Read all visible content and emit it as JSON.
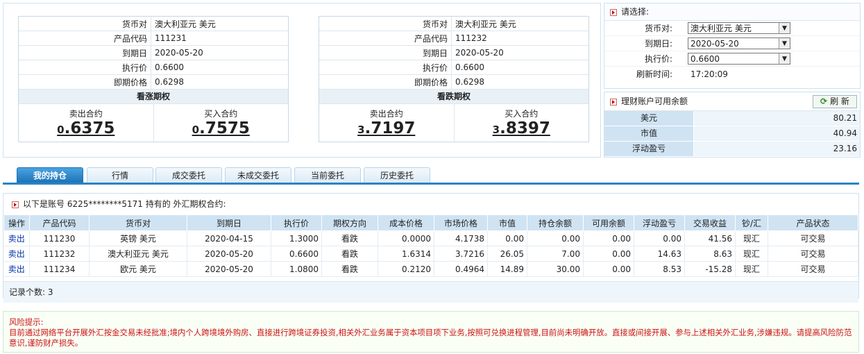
{
  "quotes": [
    {
      "pair_label": "货币对",
      "pair": "澳大利亚元 美元",
      "code_label": "产品代码",
      "code": "111231",
      "expiry_label": "到期日",
      "expiry": "2020-05-20",
      "strike_label": "执行价",
      "strike": "0.6600",
      "spot_label": "即期价格",
      "spot": "0.6298",
      "type": "看涨期权",
      "sell_label": "卖出合约",
      "sell_int": "0",
      "sell_dec": ".6375",
      "buy_label": "买入合约",
      "buy_int": "0",
      "buy_dec": ".7575"
    },
    {
      "pair_label": "货币对",
      "pair": "澳大利亚元 美元",
      "code_label": "产品代码",
      "code": "111232",
      "expiry_label": "到期日",
      "expiry": "2020-05-20",
      "strike_label": "执行价",
      "strike": "0.6600",
      "spot_label": "即期价格",
      "spot": "0.6298",
      "type": "看跌期权",
      "sell_label": "卖出合约",
      "sell_int": "3",
      "sell_dec": ".7197",
      "buy_label": "买入合约",
      "buy_int": "3",
      "buy_dec": ".8397"
    }
  ],
  "select": {
    "title": "请选择:",
    "pair_label": "货币对:",
    "pair": "澳大利亚元 美元",
    "expiry_label": "到期日:",
    "expiry": "2020-05-20",
    "strike_label": "执行价:",
    "strike": "0.6600",
    "refresh_label": "刷新时间:",
    "refresh_time": "17:20:09"
  },
  "balance": {
    "title": "理财账户可用余额",
    "refresh_btn": "刷 新",
    "rows": [
      {
        "k": "美元",
        "v": "80.21"
      },
      {
        "k": "市值",
        "v": "40.94"
      },
      {
        "k": "浮动盈亏",
        "v": "23.16"
      }
    ]
  },
  "tabs": [
    "我的持仓",
    "行情",
    "成交委托",
    "未成交委托",
    "当前委托",
    "历史委托"
  ],
  "holdings": {
    "header": "以下是账号 6225********5171 持有的 外汇期权合约:",
    "columns": [
      "操作",
      "产品代码",
      "货币对",
      "到期日",
      "执行价",
      "期权方向",
      "成本价格",
      "市场价格",
      "市值",
      "持仓余额",
      "可用余额",
      "浮动盈亏",
      "交易收益",
      "钞/汇",
      "产品状态"
    ],
    "rows": [
      [
        "卖出",
        "111230",
        "英镑 美元",
        "2020-04-15",
        "1.3000",
        "看跌",
        "0.0000",
        "4.1738",
        "0.00",
        "0.00",
        "0.00",
        "0.00",
        "41.56",
        "现汇",
        "可交易"
      ],
      [
        "卖出",
        "111232",
        "澳大利亚元 美元",
        "2020-05-20",
        "0.6600",
        "看跌",
        "1.6314",
        "3.7216",
        "26.05",
        "7.00",
        "0.00",
        "14.63",
        "8.63",
        "现汇",
        "可交易"
      ],
      [
        "卖出",
        "111234",
        "欧元 美元",
        "2020-05-20",
        "1.0800",
        "看跌",
        "0.2120",
        "0.4964",
        "14.89",
        "30.00",
        "0.00",
        "8.53",
        "-15.28",
        "现汇",
        "可交易"
      ]
    ],
    "count_label": "记录个数:",
    "count": "3"
  },
  "risk": {
    "title": "风险提示:",
    "text": "目前通过网络平台开展外汇按金交易未经批准;境内个人跨境境外购房、直接进行跨境证券投资,相关外汇业务属于资本项目项下业务,按照可兑换进程管理,目前尚未明确开放。直接或间接开展、参与上述相关外汇业务,涉嫌违规。请提高风险防范意识,谨防财产损失。"
  },
  "colors": {
    "accent": "#2b83c3",
    "header_bg": "#cfe3f3",
    "risk_text": "#cc1111"
  }
}
